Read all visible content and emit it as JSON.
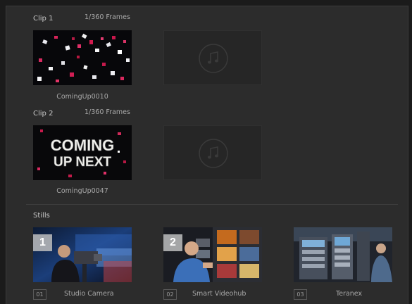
{
  "clips": [
    {
      "label": "Clip 1",
      "frames": "1/360 Frames",
      "caption": "ComingUp0010"
    },
    {
      "label": "Clip 2",
      "frames": "1/360 Frames",
      "caption": "ComingUp0047",
      "thumb_text_line1": "COMING",
      "thumb_text_line2": "UP NEXT"
    }
  ],
  "audio_icon": "music-note-icon",
  "stills": {
    "label": "Stills",
    "items": [
      {
        "badge": "1",
        "index": "01",
        "name": "Studio Camera"
      },
      {
        "badge": "2",
        "index": "02",
        "name": "Smart Videohub"
      },
      {
        "badge": "",
        "index": "03",
        "name": "Teranex"
      }
    ]
  },
  "colors": {
    "panel": "#2c2c2c",
    "background": "#1b1b1b",
    "text": "#c9c9c9",
    "audio_slot": "#262626"
  }
}
